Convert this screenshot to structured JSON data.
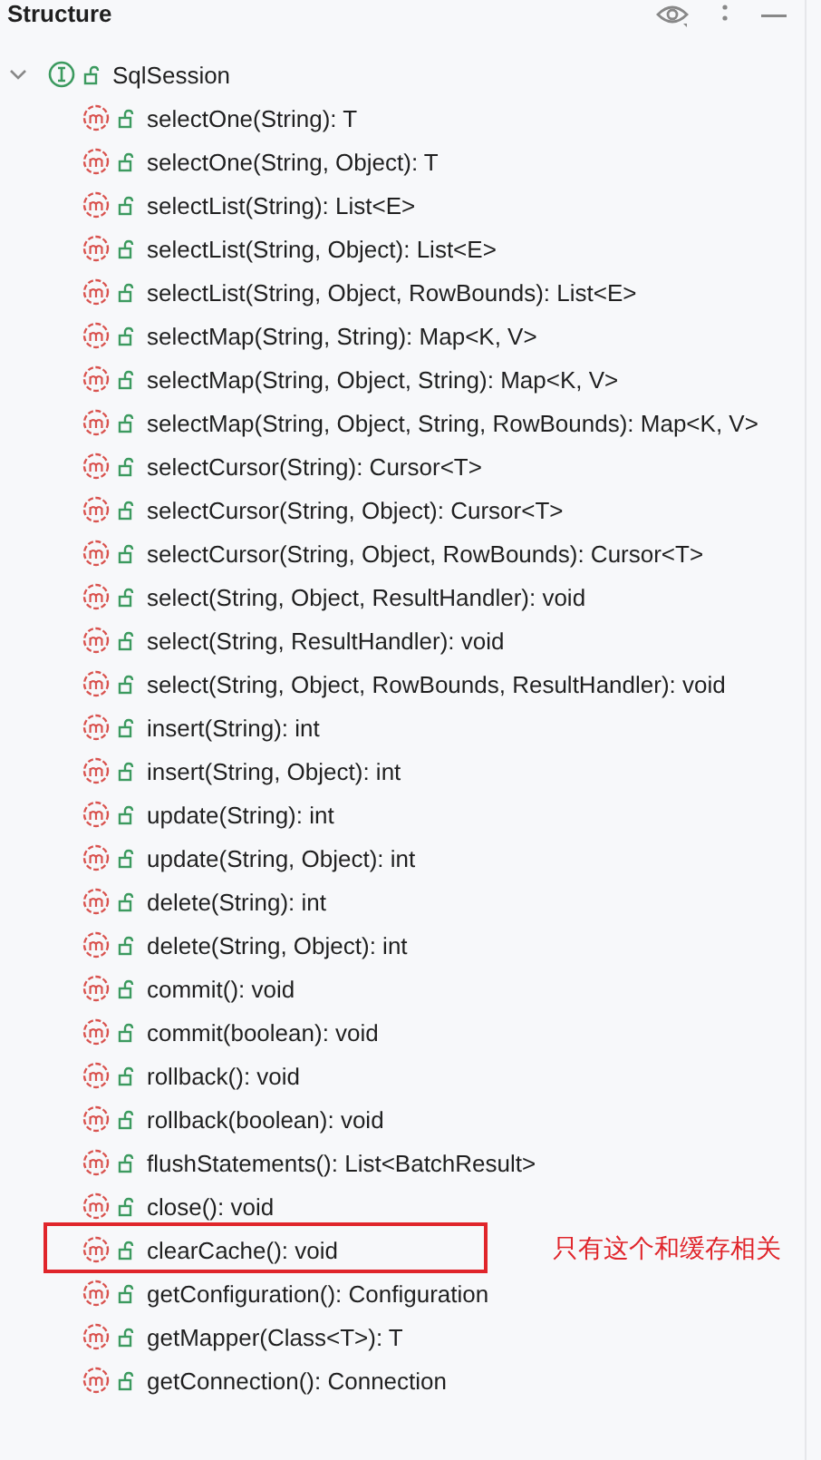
{
  "panel": {
    "title": "Structure"
  },
  "tree": [
    {
      "label": "SqlSession",
      "kind": "interface",
      "expanded": true,
      "children": [
        {
          "label": "selectOne(String): T",
          "kind": "method"
        },
        {
          "label": "selectOne(String, Object): T",
          "kind": "method"
        },
        {
          "label": "selectList(String): List<E>",
          "kind": "method"
        },
        {
          "label": "selectList(String, Object): List<E>",
          "kind": "method"
        },
        {
          "label": "selectList(String, Object, RowBounds): List<E>",
          "kind": "method"
        },
        {
          "label": "selectMap(String, String): Map<K, V>",
          "kind": "method"
        },
        {
          "label": "selectMap(String, Object, String): Map<K, V>",
          "kind": "method"
        },
        {
          "label": "selectMap(String, Object, String, RowBounds): Map<K, V>",
          "kind": "method"
        },
        {
          "label": "selectCursor(String): Cursor<T>",
          "kind": "method"
        },
        {
          "label": "selectCursor(String, Object): Cursor<T>",
          "kind": "method"
        },
        {
          "label": "selectCursor(String, Object, RowBounds): Cursor<T>",
          "kind": "method"
        },
        {
          "label": "select(String, Object, ResultHandler): void",
          "kind": "method"
        },
        {
          "label": "select(String, ResultHandler): void",
          "kind": "method"
        },
        {
          "label": "select(String, Object, RowBounds, ResultHandler): void",
          "kind": "method"
        },
        {
          "label": "insert(String): int",
          "kind": "method"
        },
        {
          "label": "insert(String, Object): int",
          "kind": "method"
        },
        {
          "label": "update(String): int",
          "kind": "method"
        },
        {
          "label": "update(String, Object): int",
          "kind": "method"
        },
        {
          "label": "delete(String): int",
          "kind": "method"
        },
        {
          "label": "delete(String, Object): int",
          "kind": "method"
        },
        {
          "label": "commit(): void",
          "kind": "method"
        },
        {
          "label": "commit(boolean): void",
          "kind": "method"
        },
        {
          "label": "rollback(): void",
          "kind": "method"
        },
        {
          "label": "rollback(boolean): void",
          "kind": "method"
        },
        {
          "label": "flushStatements(): List<BatchResult>",
          "kind": "method"
        },
        {
          "label": "close(): void",
          "kind": "method"
        },
        {
          "label": "clearCache(): void",
          "kind": "method",
          "note": "只有这个和缓存相关"
        },
        {
          "label": "getConfiguration(): Configuration",
          "kind": "method"
        },
        {
          "label": "getMapper(Class<T>): T",
          "kind": "method"
        },
        {
          "label": "getConnection(): Connection",
          "kind": "method"
        }
      ]
    }
  ]
}
